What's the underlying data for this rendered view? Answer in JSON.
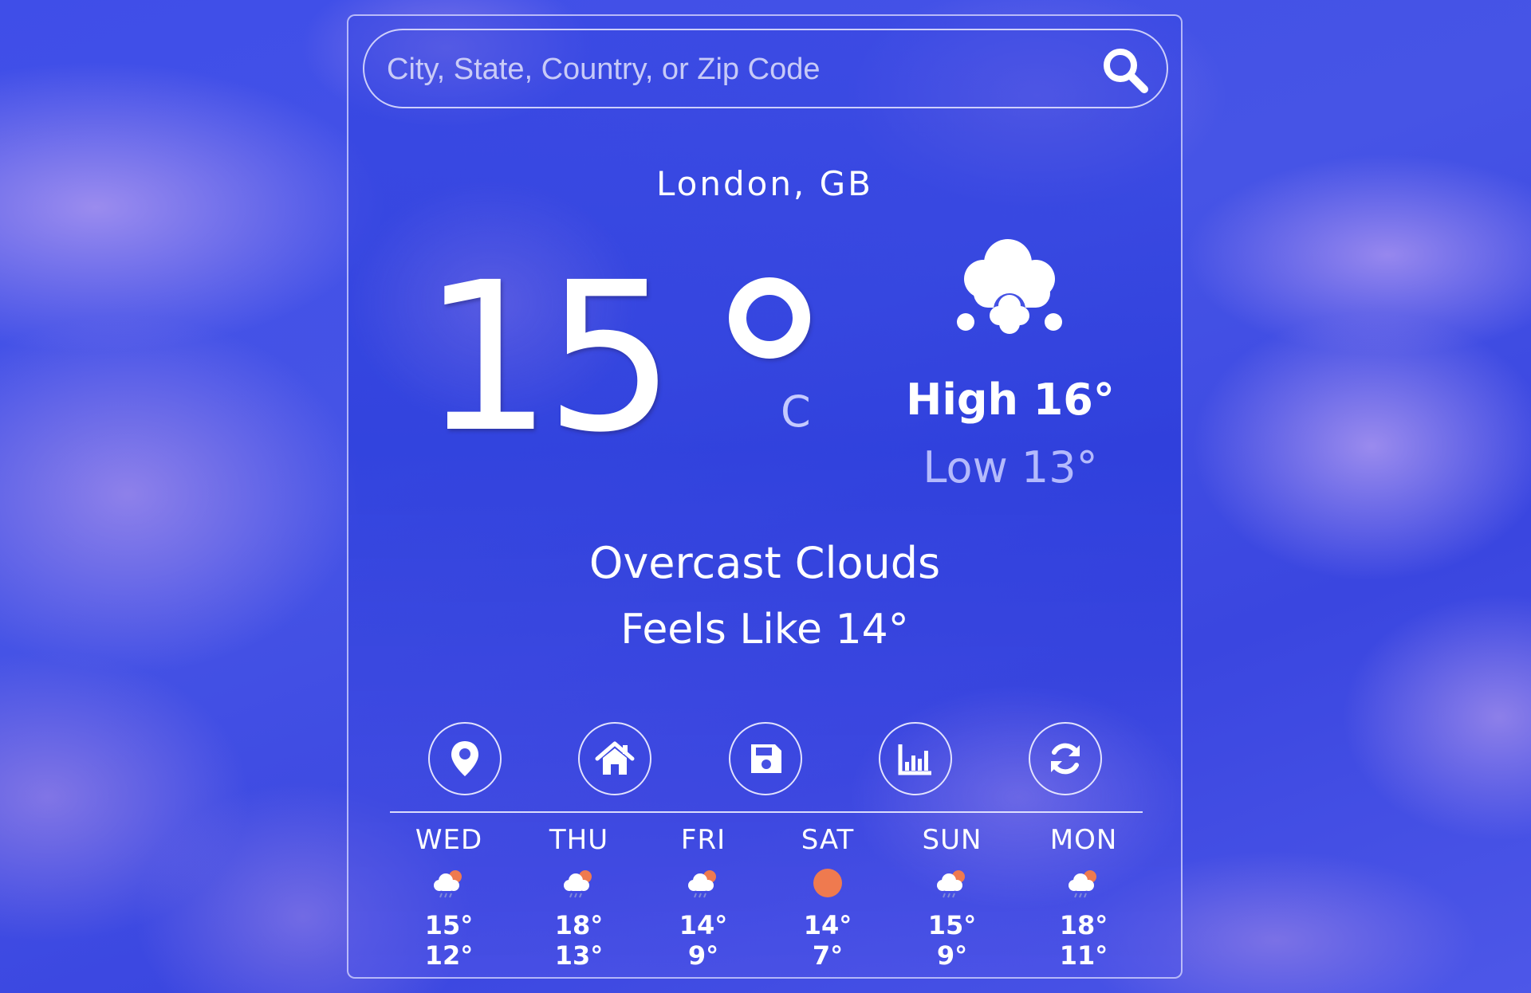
{
  "search": {
    "placeholder": "City, State, Country, or Zip Code",
    "value": "",
    "icon": "search-icon"
  },
  "location": "London, GB",
  "current": {
    "temp": "15",
    "unit": "C",
    "condition_icon": "overcast-clouds-icon",
    "high": "High 16°",
    "low": "Low 13°",
    "description": "Overcast Clouds",
    "feels_like": "Feels Like 14°"
  },
  "actions": [
    {
      "icon": "location-pin-icon"
    },
    {
      "icon": "home-icon"
    },
    {
      "icon": "save-icon"
    },
    {
      "icon": "chart-icon"
    },
    {
      "icon": "refresh-icon"
    }
  ],
  "forecast": [
    {
      "day": "WED",
      "icon": "cloud-rain-sun-icon",
      "high": "15°",
      "low": "12°"
    },
    {
      "day": "THU",
      "icon": "cloud-rain-sun-icon",
      "high": "18°",
      "low": "13°"
    },
    {
      "day": "FRI",
      "icon": "cloud-rain-sun-icon",
      "high": "14°",
      "low": "9°"
    },
    {
      "day": "SAT",
      "icon": "sun-icon",
      "high": "14°",
      "low": "7°"
    },
    {
      "day": "SUN",
      "icon": "cloud-rain-sun-icon",
      "high": "15°",
      "low": "9°"
    },
    {
      "day": "MON",
      "icon": "cloud-rain-sun-icon",
      "high": "18°",
      "low": "11°"
    }
  ],
  "colors": {
    "background": "#4a52e6",
    "sun": "#ef7a4f",
    "text": "#ffffff"
  }
}
